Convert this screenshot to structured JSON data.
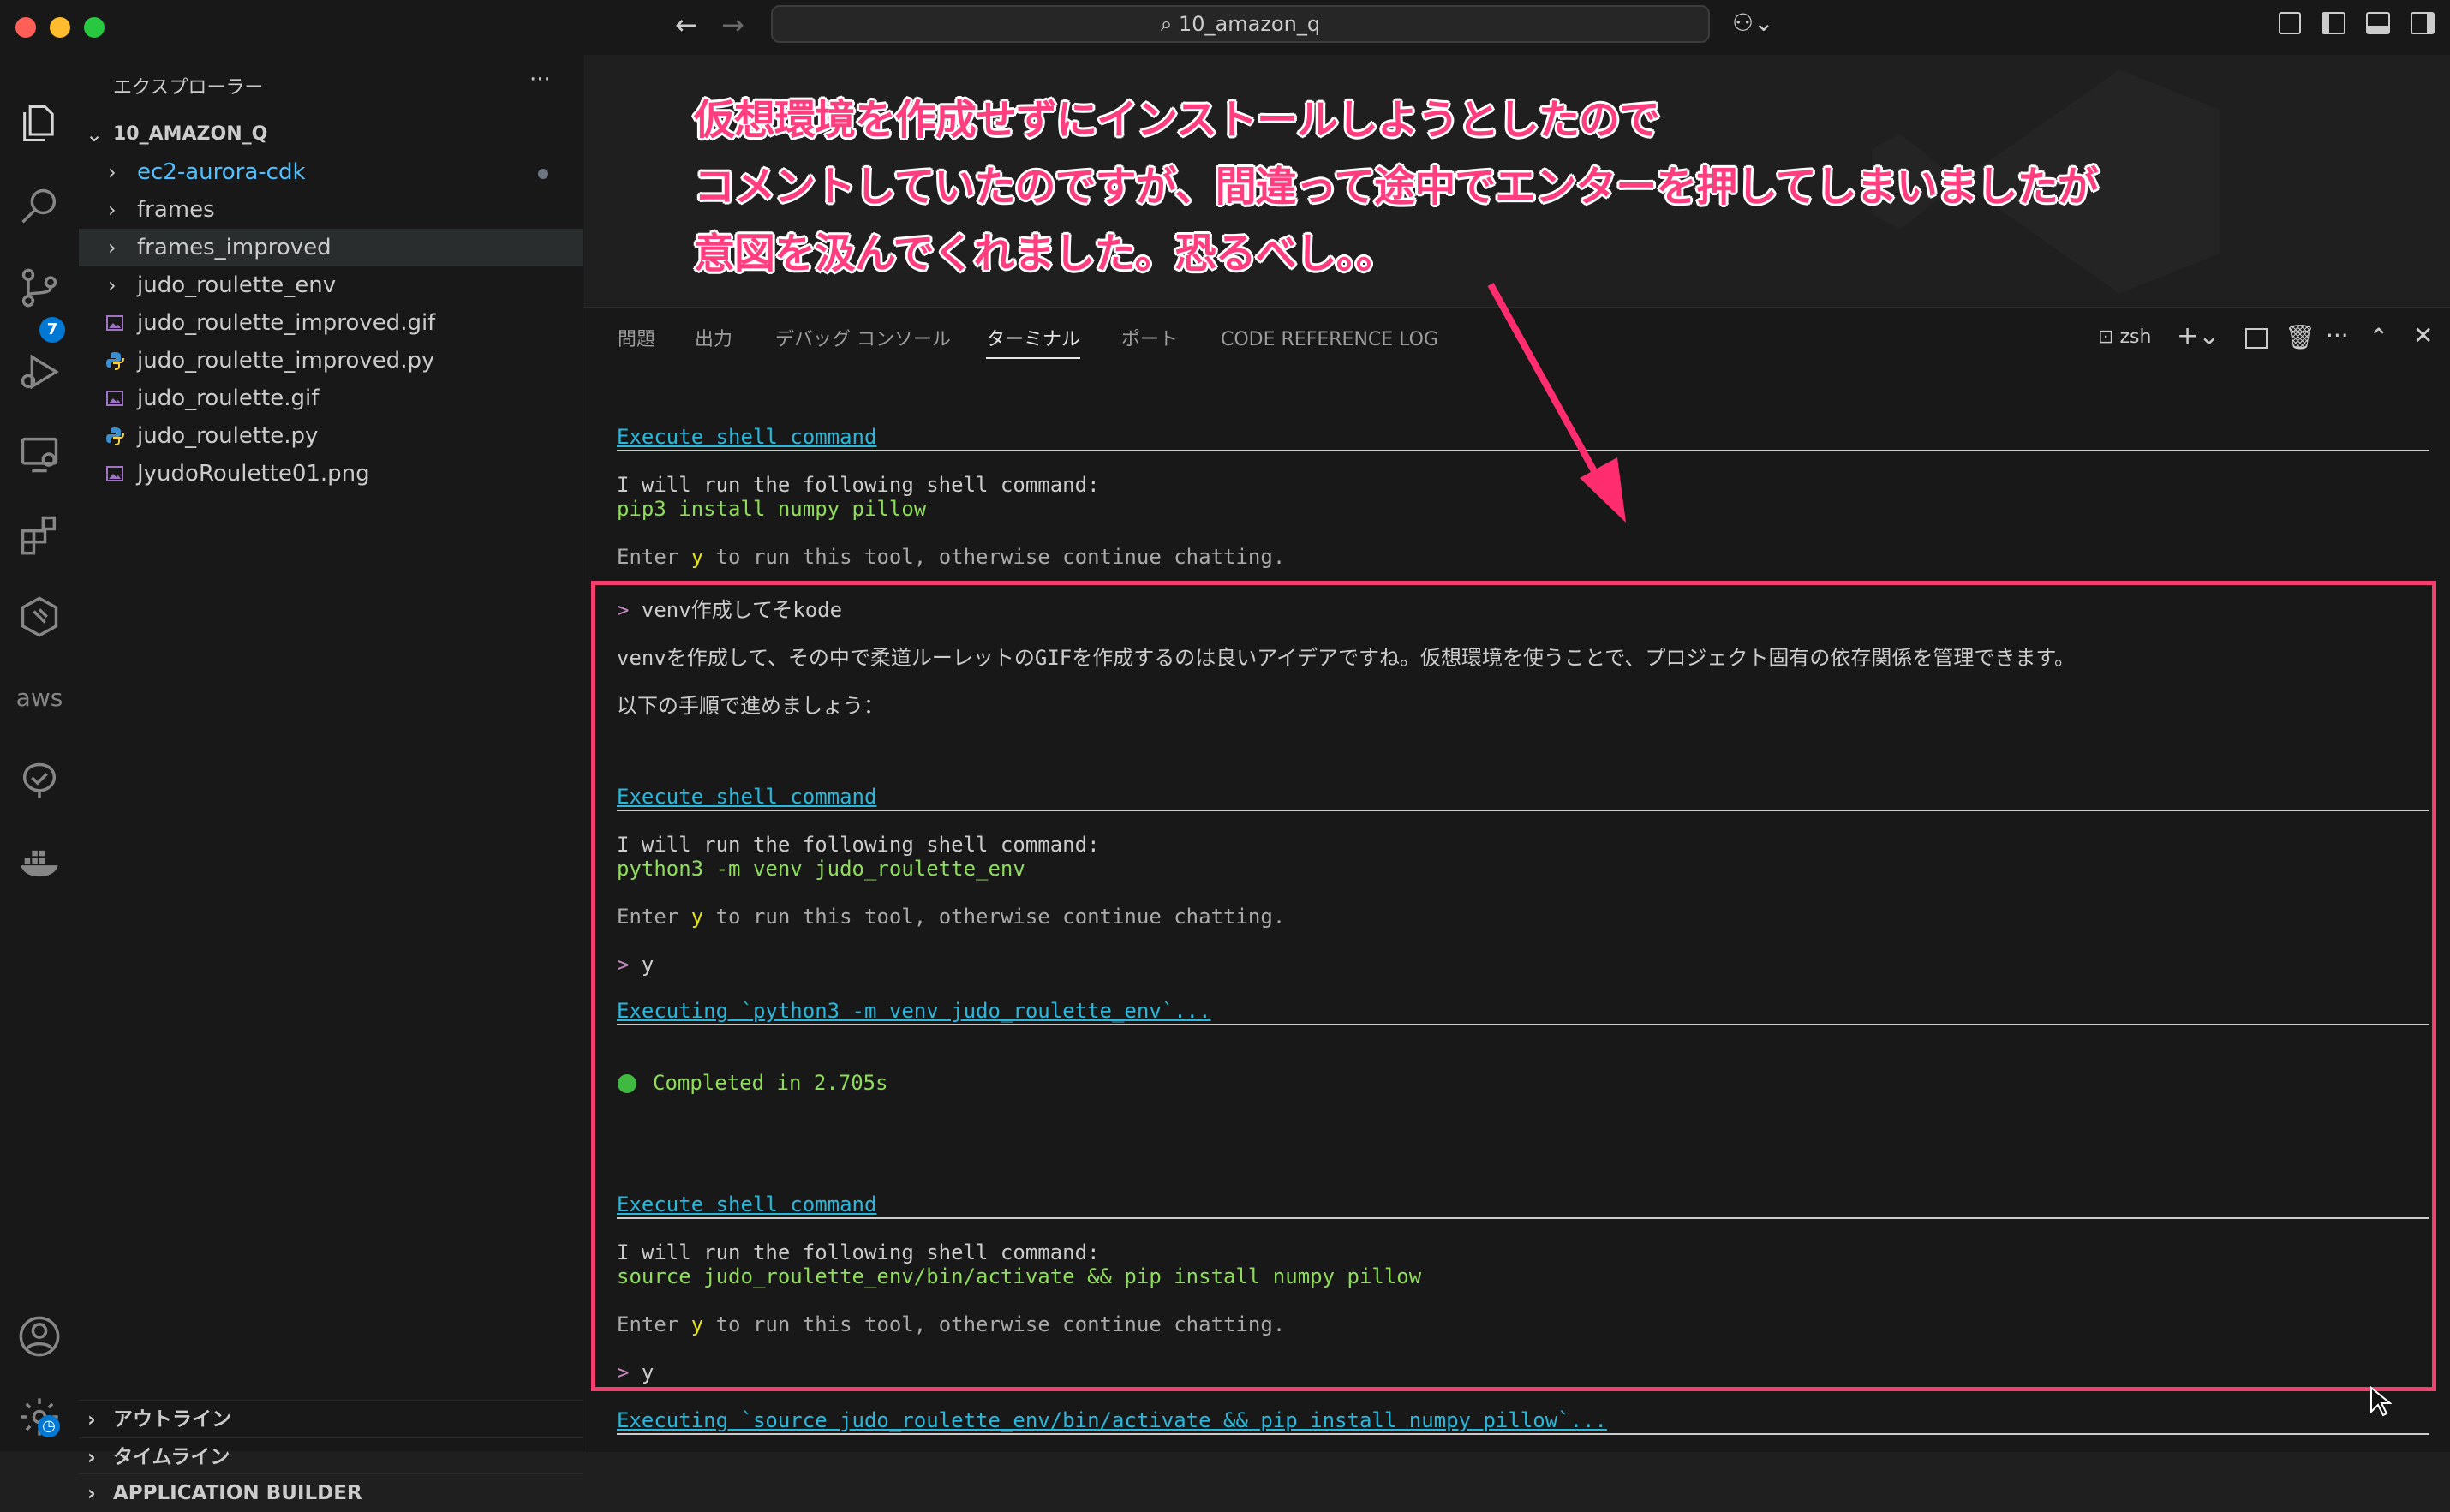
{
  "window": {
    "search_title": "10_amazon_q",
    "traffic_colors": [
      "#ff5f57",
      "#febc2e",
      "#28c840"
    ]
  },
  "activity_bar": {
    "items": [
      "explorer-icon",
      "search-icon",
      "source-control-icon",
      "run-debug-icon",
      "remote-explorer-icon",
      "extensions-icon",
      "amazon-q-icon",
      "aws-icon",
      "testing-icon",
      "docker-icon"
    ],
    "source_control_badge": "7",
    "aws_label": "aws"
  },
  "sidebar": {
    "title": "エクスプローラー",
    "more": "···",
    "root": "10_AMAZON_Q",
    "items": [
      {
        "label": "ec2-aurora-cdk",
        "type": "folder",
        "color": "#4fc1ff"
      },
      {
        "label": "frames",
        "type": "folder"
      },
      {
        "label": "frames_improved",
        "type": "folder",
        "selected": true
      },
      {
        "label": "judo_roulette_env",
        "type": "folder"
      },
      {
        "label": "judo_roulette_improved.gif",
        "type": "image"
      },
      {
        "label": "judo_roulette_improved.py",
        "type": "python"
      },
      {
        "label": "judo_roulette.gif",
        "type": "image"
      },
      {
        "label": "judo_roulette.py",
        "type": "python"
      },
      {
        "label": "JyudoRoulette01.png",
        "type": "image"
      }
    ],
    "sections": [
      "アウトライン",
      "タイムライン",
      "APPLICATION BUILDER"
    ]
  },
  "annotation": {
    "lines": [
      "仮想環境を作成せずにインストールしようとしたので",
      "コメントしていたのですが、間違って途中でエンターを押してしまいましたが",
      "意図を汲んでくれました。恐るべし。。"
    ],
    "color": "#ff3d7f"
  },
  "panel": {
    "tabs": [
      "問題",
      "出力",
      "デバッグ コンソール",
      "ターミナル",
      "ポート",
      "CODE REFERENCE LOG"
    ],
    "active_tab": "ターミナル",
    "shell": "zsh"
  },
  "terminal": {
    "exec1_header": "Execute shell command",
    "exec1_intro": "I will run the following shell command:",
    "exec1_cmd": "pip3 install numpy pillow",
    "exec1_prompt_a": "Enter ",
    "exec1_prompt_y": "y",
    "exec1_prompt_b": " to run this tool, otherwise continue chatting.",
    "user_prompt_symbol": ">",
    "user_input": "venv作成してそkode",
    "reply_line1": "venvを作成して、その中で柔道ルーレットのGIFを作成するのは良いアイデアですね。仮想環境を使うことで、プロジェクト固有の依存関係を管理できます。",
    "reply_line2": "以下の手順で進めましょう：",
    "exec2_header": "Execute shell command",
    "exec2_intro": "I will run the following shell command:",
    "exec2_cmd": "python3 -m venv judo_roulette_env",
    "exec2_prompt_a": "Enter ",
    "exec2_prompt_y": "y",
    "exec2_prompt_b": " to run this tool, otherwise continue chatting.",
    "answer2": "y",
    "executing2": "Executing `python3 -m venv judo_roulette_env`...",
    "completed": "Completed in 2.705s",
    "exec3_header": "Execute shell command",
    "exec3_intro": "I will run the following shell command:",
    "exec3_cmd": "source judo_roulette_env/bin/activate && pip install numpy pillow",
    "exec3_prompt_a": "Enter ",
    "exec3_prompt_y": "y",
    "exec3_prompt_b": " to run this tool, otherwise continue chatting.",
    "answer3": "y",
    "executing3": "Executing `source judo_roulette_env/bin/activate && pip install numpy pillow`..."
  }
}
